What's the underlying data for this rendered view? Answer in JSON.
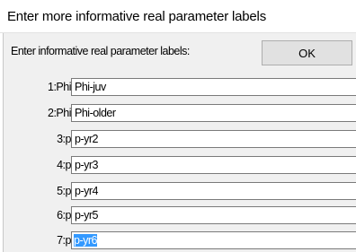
{
  "window": {
    "title": "Enter more informative real parameter labels"
  },
  "dialog": {
    "prompt": "Enter informative real parameter labels:",
    "ok_label": "OK",
    "rows": [
      {
        "label": "1:Phi",
        "value": "Phi-juv"
      },
      {
        "label": "2:Phi",
        "value": "Phi-older"
      },
      {
        "label": "3:p",
        "value": "p-yr2"
      },
      {
        "label": "4:p",
        "value": "p-yr3"
      },
      {
        "label": "5:p",
        "value": "p-yr4"
      },
      {
        "label": "6:p",
        "value": "p-yr5"
      },
      {
        "label": "7:p",
        "value": "p-yr6"
      }
    ]
  },
  "colors": {
    "selection": "#3399ff",
    "dialog_bg": "#f0f0f0",
    "field_border": "#7a7a7a"
  }
}
